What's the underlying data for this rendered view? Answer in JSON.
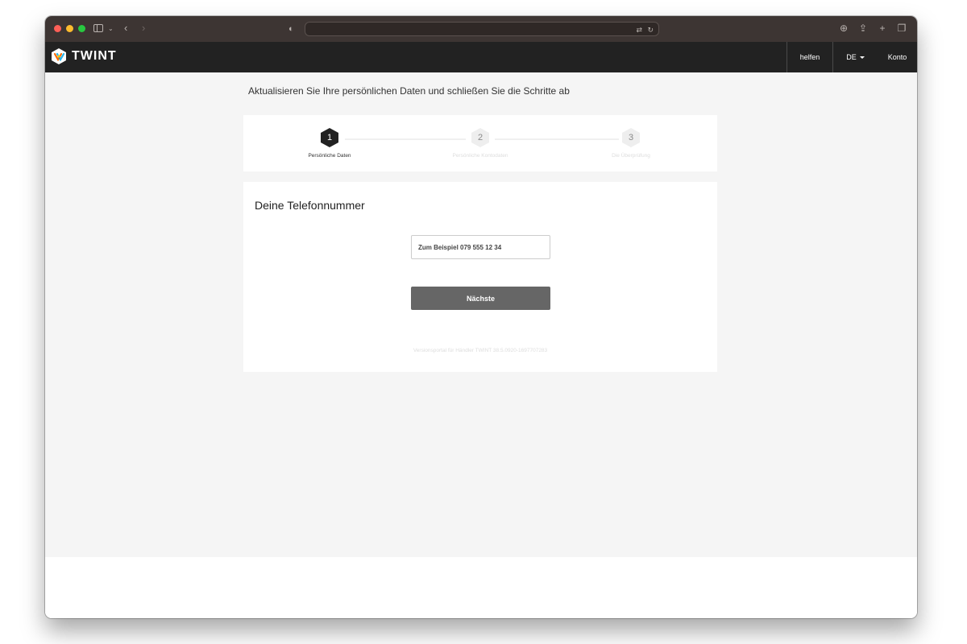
{
  "header": {
    "brand": "TWINT",
    "nav": {
      "help": "helfen",
      "language": "DE",
      "account": "Konto"
    }
  },
  "page": {
    "heading": "Aktualisieren Sie Ihre persönlichen Daten und schließen Sie die Schritte ab"
  },
  "steps": [
    {
      "number": "1",
      "label": "Persönliche Daten",
      "active": true
    },
    {
      "number": "2",
      "label": "Persönliche Kontodaten",
      "active": false
    },
    {
      "number": "3",
      "label": "Die Überprüfung",
      "active": false
    }
  ],
  "form": {
    "title": "Deine Telefonnummer",
    "phone_placeholder": "Zum Beispiel 079 555 12 34",
    "phone_value": "",
    "next_label": "Nächste",
    "version": "Versionsportal für Händler TWINT 38.5.0920-1697707283"
  },
  "colors": {
    "header_bg": "#222222",
    "button_bg": "#666666",
    "page_bg": "#f5f5f5"
  }
}
